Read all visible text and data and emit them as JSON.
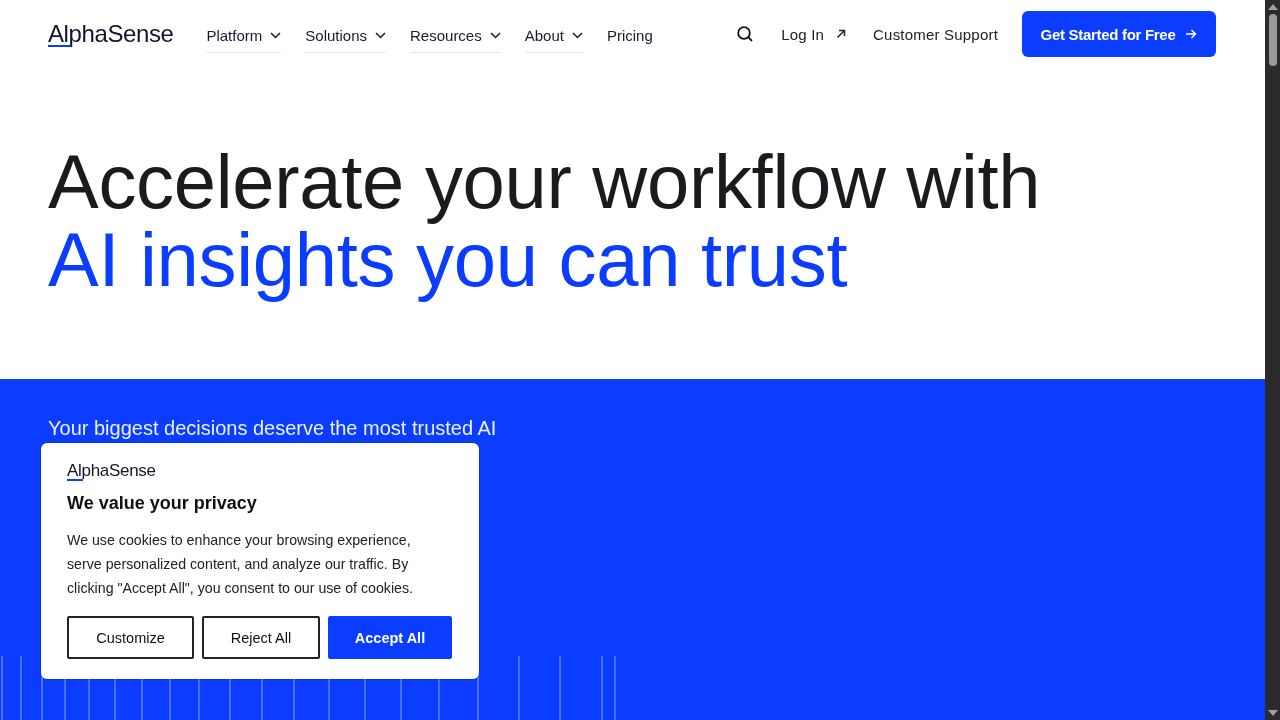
{
  "header": {
    "logo": "AlphaSense",
    "nav": [
      {
        "label": "Platform",
        "has_menu": true
      },
      {
        "label": "Solutions",
        "has_menu": true
      },
      {
        "label": "Resources",
        "has_menu": true
      },
      {
        "label": "About",
        "has_menu": true
      },
      {
        "label": "Pricing",
        "has_menu": false
      }
    ],
    "login": "Log In",
    "support": "Customer Support",
    "cta": "Get Started for Free"
  },
  "hero": {
    "heading_line_1": "Accelerate your workflow with",
    "heading_line_2": "AI insights you can trust",
    "subtitle": "Your biggest decisions deserve the most trusted AI"
  },
  "cookie_dialog": {
    "logo": "AlphaSense",
    "title": "We value your privacy",
    "text": "We use cookies to enhance your browsing experience, serve personalized content, and analyze our traffic. By clicking \"Accept All\", you consent to our use of cookies.",
    "buttons": [
      {
        "label": "Customize",
        "kind": "outline"
      },
      {
        "label": "Reject All",
        "kind": "outline"
      },
      {
        "label": "Accept All",
        "kind": "primary"
      }
    ]
  }
}
